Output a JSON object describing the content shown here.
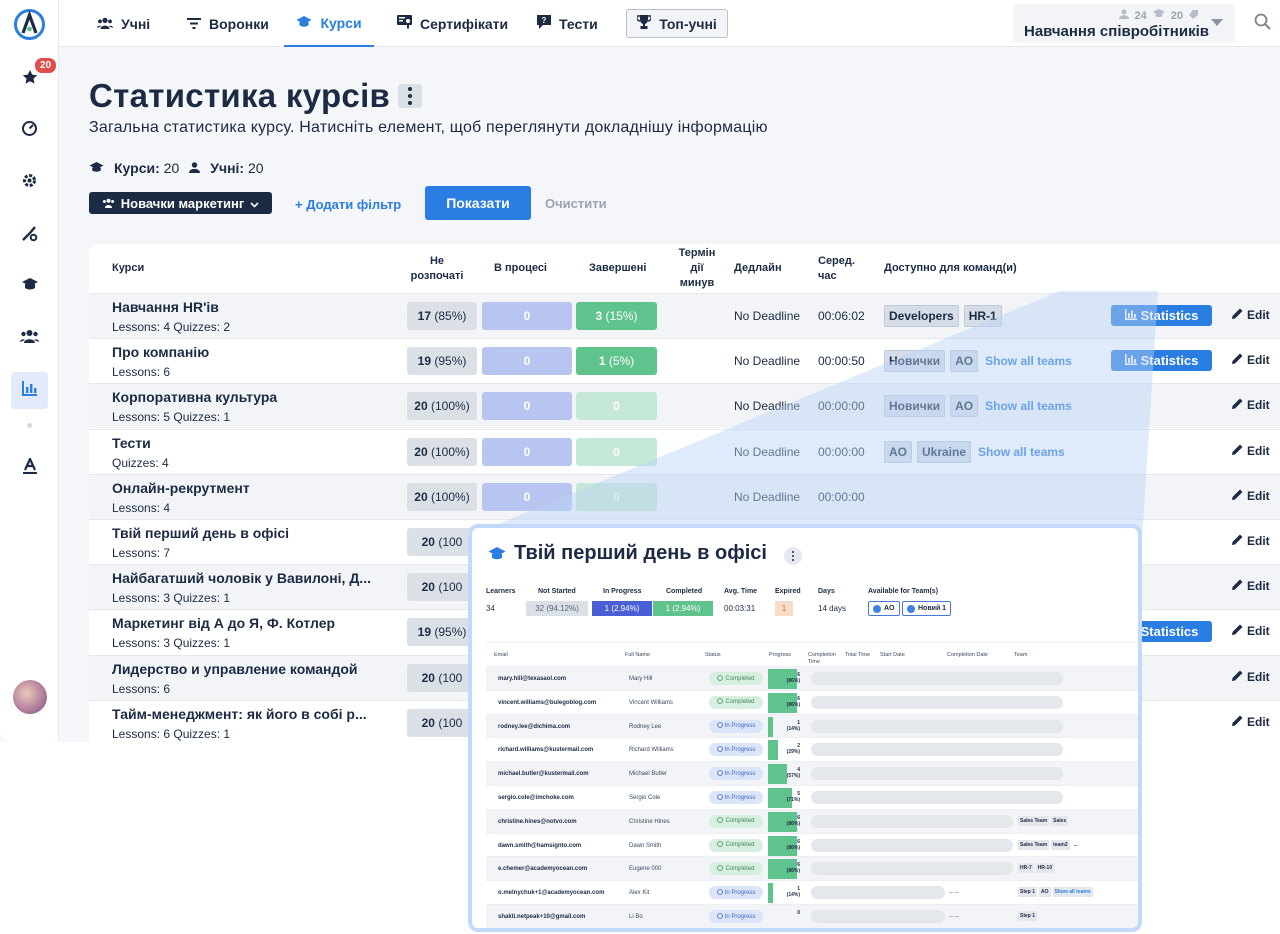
{
  "sidebar": {
    "badge": "20"
  },
  "nav": {
    "tabs": [
      "Учні",
      "Воронки",
      "Курси",
      "Сертифікати",
      "Тести"
    ],
    "top_button": "Топ-учні"
  },
  "org": {
    "learners": "24",
    "courses": "20",
    "name": "Навчання співробітників"
  },
  "header": {
    "title": "Статистика курсів",
    "subtitle": "Загальна статистика курсу. Натисніть елемент, щоб переглянути докладнішу інформацію",
    "courses_label": "Курси:",
    "courses_count": "20",
    "learners_label": "Учні:",
    "learners_count": "20"
  },
  "filters": {
    "chip": "Новачки маркетинг",
    "add": "+ Додати фільтр",
    "show": "Показати",
    "clear": "Очистити"
  },
  "columns": {
    "course": "Курси",
    "not_started": "Не розпочаті",
    "in_progress": "В процесі",
    "completed": "Завершені",
    "expired": "Термін дії минув",
    "deadline": "Дедлайн",
    "avg_time": "Серед. час",
    "teams": "Доступно для команд(и)"
  },
  "actions": {
    "statistics": "Statistics",
    "edit": "Edit",
    "show_all": "Show all teams"
  },
  "courses": [
    {
      "name": "Навчання HR'ів",
      "sub": "Lessons: 4 Quizzes: 2",
      "ns": "17",
      "nsp": "(85%)",
      "ip": "0",
      "cp": "3",
      "cpp": "(15%)",
      "deadline": "No Deadline",
      "time": "00:06:02",
      "teams": [
        "Developers",
        "HR-1"
      ]
    },
    {
      "name": "Про компанію",
      "sub": "Lessons: 6",
      "ns": "19",
      "nsp": "(95%)",
      "ip": "0",
      "cp": "1",
      "cpp": "(5%)",
      "deadline": "No Deadline",
      "time": "00:00:50",
      "teams": [
        "Новички",
        "AO"
      ]
    },
    {
      "name": "Корпоративна культура",
      "sub": "Lessons: 5 Quizzes: 1",
      "ns": "20",
      "nsp": "(100%)",
      "ip": "0",
      "cp": "0",
      "cpp": "",
      "deadline": "No Deadline",
      "time": "00:00:00",
      "teams": [
        "Новички",
        "AO"
      ]
    },
    {
      "name": "Тести",
      "sub": "Quizzes: 4",
      "ns": "20",
      "nsp": "(100%)",
      "ip": "0",
      "cp": "0",
      "cpp": "",
      "deadline": "No Deadline",
      "time": "00:00:00",
      "teams": [
        "AO",
        "Ukraine"
      ]
    },
    {
      "name": "Онлайн-рекрутмент",
      "sub": "Lessons: 4",
      "ns": "20",
      "nsp": "(100%)",
      "ip": "0",
      "cp": "0",
      "cpp": "",
      "deadline": "No Deadline",
      "time": "00:00:00",
      "teams": []
    },
    {
      "name": "Твій перший день в офісі",
      "sub": "Lessons: 7",
      "ns": "20",
      "nsp": "(100",
      "ip": "",
      "cp": "",
      "cpp": "",
      "deadline": "",
      "time": "",
      "teams": []
    },
    {
      "name": "Найбагатший чоловік у Вавилоні, Д...",
      "sub": "Lessons: 3 Quizzes: 1",
      "ns": "20",
      "nsp": "(100",
      "ip": "",
      "cp": "",
      "cpp": "",
      "deadline": "",
      "time": "",
      "teams": []
    },
    {
      "name": "Маркетинг від А до Я, Ф. Котлер",
      "sub": "Lessons: 3 Quizzes: 1",
      "ns": "19",
      "nsp": "(95%)",
      "ip": "",
      "cp": "",
      "cpp": "",
      "deadline": "",
      "time": "",
      "teams": []
    },
    {
      "name": "Лидерство и управление командой",
      "sub": "Lessons: 6",
      "ns": "20",
      "nsp": "(100",
      "ip": "",
      "cp": "",
      "cpp": "",
      "deadline": "",
      "time": "",
      "teams": []
    },
    {
      "name": "Тайм-менеджмент: як його в собі р...",
      "sub": "Lessons: 6 Quizzes: 1",
      "ns": "20",
      "nsp": "(100",
      "ip": "",
      "cp": "",
      "cpp": "",
      "deadline": "",
      "time": "",
      "teams": []
    }
  ],
  "popup": {
    "title": "Твій перший день в офісі",
    "heads": [
      "Learners",
      "Not Started",
      "In Progress",
      "Completed",
      "Avg. Time",
      "Expired",
      "Days",
      "Available for Team(s)"
    ],
    "learners": "34",
    "not_started": "32 (94.12%)",
    "in_progress": "1 (2.94%)",
    "completed": "1 (2.94%)",
    "avg_time": "00:03:31",
    "expired": "1",
    "days": "14 days",
    "teams": [
      "AO",
      "Новий 1"
    ],
    "grid_heads": [
      "Email",
      "Full Name",
      "Status",
      "Progress",
      "Completion Time",
      "Total Time",
      "Start Date",
      "Completion Date",
      "Team"
    ],
    "rows": [
      {
        "email": "mary.hill@texasaol.com",
        "name": "Mary Hill",
        "status": "Completed",
        "p": "6",
        "pp": "(86%)",
        "f": 0.86,
        "teams": [],
        "more": ""
      },
      {
        "email": "vincent.williams@bulegoblog.com",
        "name": "Vincent Williams",
        "status": "Completed",
        "p": "6",
        "pp": "(86%)",
        "f": 0.86,
        "teams": [],
        "more": ""
      },
      {
        "email": "rodney.lee@dichima.com",
        "name": "Rodney Lee",
        "status": "In Progress",
        "p": "1",
        "pp": "(14%)",
        "f": 0.14,
        "teams": [],
        "more": ""
      },
      {
        "email": "richard.williams@kustermail.com",
        "name": "Richard Williams",
        "status": "In Progress",
        "p": "2",
        "pp": "(29%)",
        "f": 0.29,
        "teams": [],
        "more": ""
      },
      {
        "email": "michael.butler@kustermail.com",
        "name": "Michael Butler",
        "status": "In Progress",
        "p": "4",
        "pp": "(57%)",
        "f": 0.57,
        "teams": [],
        "more": ""
      },
      {
        "email": "sergio.cole@imchoke.com",
        "name": "Sergio Cole",
        "status": "In Progress",
        "p": "5",
        "pp": "(71%)",
        "f": 0.71,
        "teams": [],
        "more": ""
      },
      {
        "email": "christine.hines@notvo.com",
        "name": "Christine Hines",
        "status": "Completed",
        "p": "6",
        "pp": "(86%)",
        "f": 0.86,
        "teams": [
          "Sales Team",
          "Sales"
        ],
        "more": ""
      },
      {
        "email": "dawn.smith@hamsignto.com",
        "name": "Dawn Smith",
        "status": "Completed",
        "p": "6",
        "pp": "(86%)",
        "f": 0.86,
        "teams": [
          "Sales Team",
          "team2"
        ],
        "more": "..."
      },
      {
        "email": "e.chemer@academyocean.com",
        "name": "Eugene 000",
        "status": "Completed",
        "p": "6",
        "pp": "(86%)",
        "f": 0.86,
        "teams": [
          "HR-7",
          "HR-10"
        ],
        "more": ""
      },
      {
        "email": "o.melnychuk+1@academyocean.com",
        "name": "Alex Kit",
        "status": "In Progress",
        "p": "1",
        "pp": "(14%)",
        "f": 0.14,
        "teams": [
          "Step 1",
          "AO"
        ],
        "more": "Show all teams",
        "dash": "-- --"
      },
      {
        "email": "shakti.netpeak+10@gmail.com",
        "name": "Li Bo",
        "status": "In Progress",
        "p": "0",
        "pp": "",
        "f": 0,
        "teams": [
          "Step 1"
        ],
        "more": "",
        "dash": "-- --"
      }
    ]
  }
}
